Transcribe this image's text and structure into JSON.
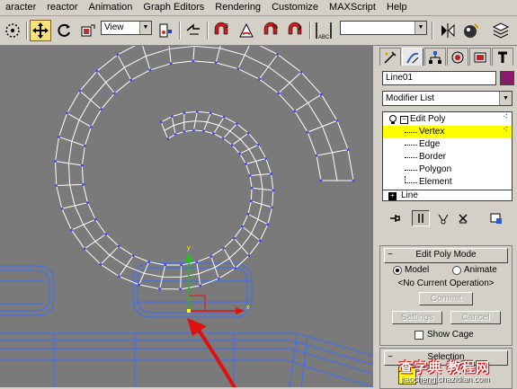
{
  "menu": [
    "aracter",
    "reactor",
    "Animation",
    "Graph Editors",
    "Rendering",
    "Customize",
    "MAXScript",
    "Help"
  ],
  "toolbar": {
    "refcoord": "View",
    "named_selection": "",
    "abc_label": "ABC"
  },
  "panel": {
    "object_name": "Line01",
    "object_color": "#8a1a6a",
    "modifier_list": "Modifier List",
    "stack": {
      "edit_poly": "Edit Poly",
      "vertex": "Vertex",
      "edge": "Edge",
      "border": "Border",
      "polygon": "Polygon",
      "element": "Element",
      "line": "Line"
    },
    "edit_poly_mode": {
      "title": "Edit Poly Mode",
      "model": "Model",
      "animate": "Animate",
      "status": "<No Current Operation>",
      "commit": "Commit",
      "settings": "Settings",
      "cancel": "Cancel",
      "show_cage": "Show Cage"
    },
    "selection_title": "Selection",
    "rollout_toggle_minus": "−",
    "rollout_toggle_plus": "+"
  },
  "watermark": {
    "main": "查字典 教程网",
    "sub": "jiaocheng.chazidian.com"
  },
  "colors": {
    "viewport_bg": "#7a7a7a",
    "spline": "#ffffff",
    "vertex_marker": "#4040ff",
    "scene_blue": "#3a6cff",
    "gizmo_yellow": "#ffff00",
    "arrow_red": "#e01010",
    "selection_highlight": "#ffff00"
  }
}
